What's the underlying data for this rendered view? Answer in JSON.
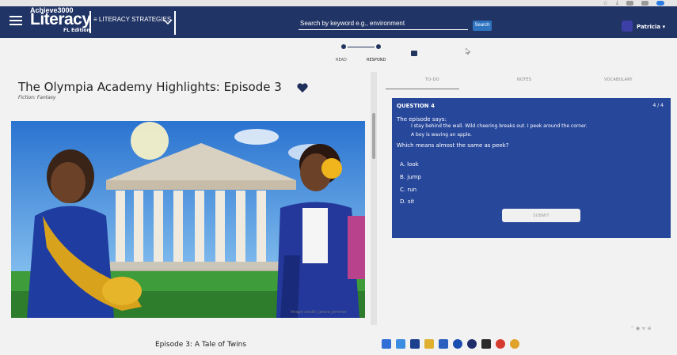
{
  "header": {
    "brand_top": "Achieve3000",
    "brand_main": "Literacy",
    "brand_edition": "FL Edition",
    "literacy_menu": "≡ LITERACY STRATEGIES",
    "search_placeholder": "Search by keyword e.g., environment",
    "search_button": "Search",
    "username": "Patricia ▾"
  },
  "steps": {
    "read": "READ",
    "respond": "RESPOND"
  },
  "tabs": {
    "todo": "TO-DO",
    "notes": "NOTES",
    "vocabulary": "VOCABULARY"
  },
  "story": {
    "title": "The Olympia Academy Highlights: Episode 3",
    "genre": "Fiction: Fantasy",
    "image_credit": "Image credit: Janice Jammer",
    "chapter": "Episode 3: A Tale of Twins"
  },
  "question": {
    "heading": "QUESTION 4",
    "count": "4 / 4",
    "intro": "The episode says:",
    "quote_line1": "I stay behind the wall. Wild cheering breaks out. I peek around the corner.",
    "quote_line2": "A boy is waving an apple.",
    "prompt": "Which means almost the same as peek?",
    "answers": [
      "A. look",
      "B. jump",
      "C. run",
      "D. sit"
    ],
    "submit": "SUBMIT"
  }
}
